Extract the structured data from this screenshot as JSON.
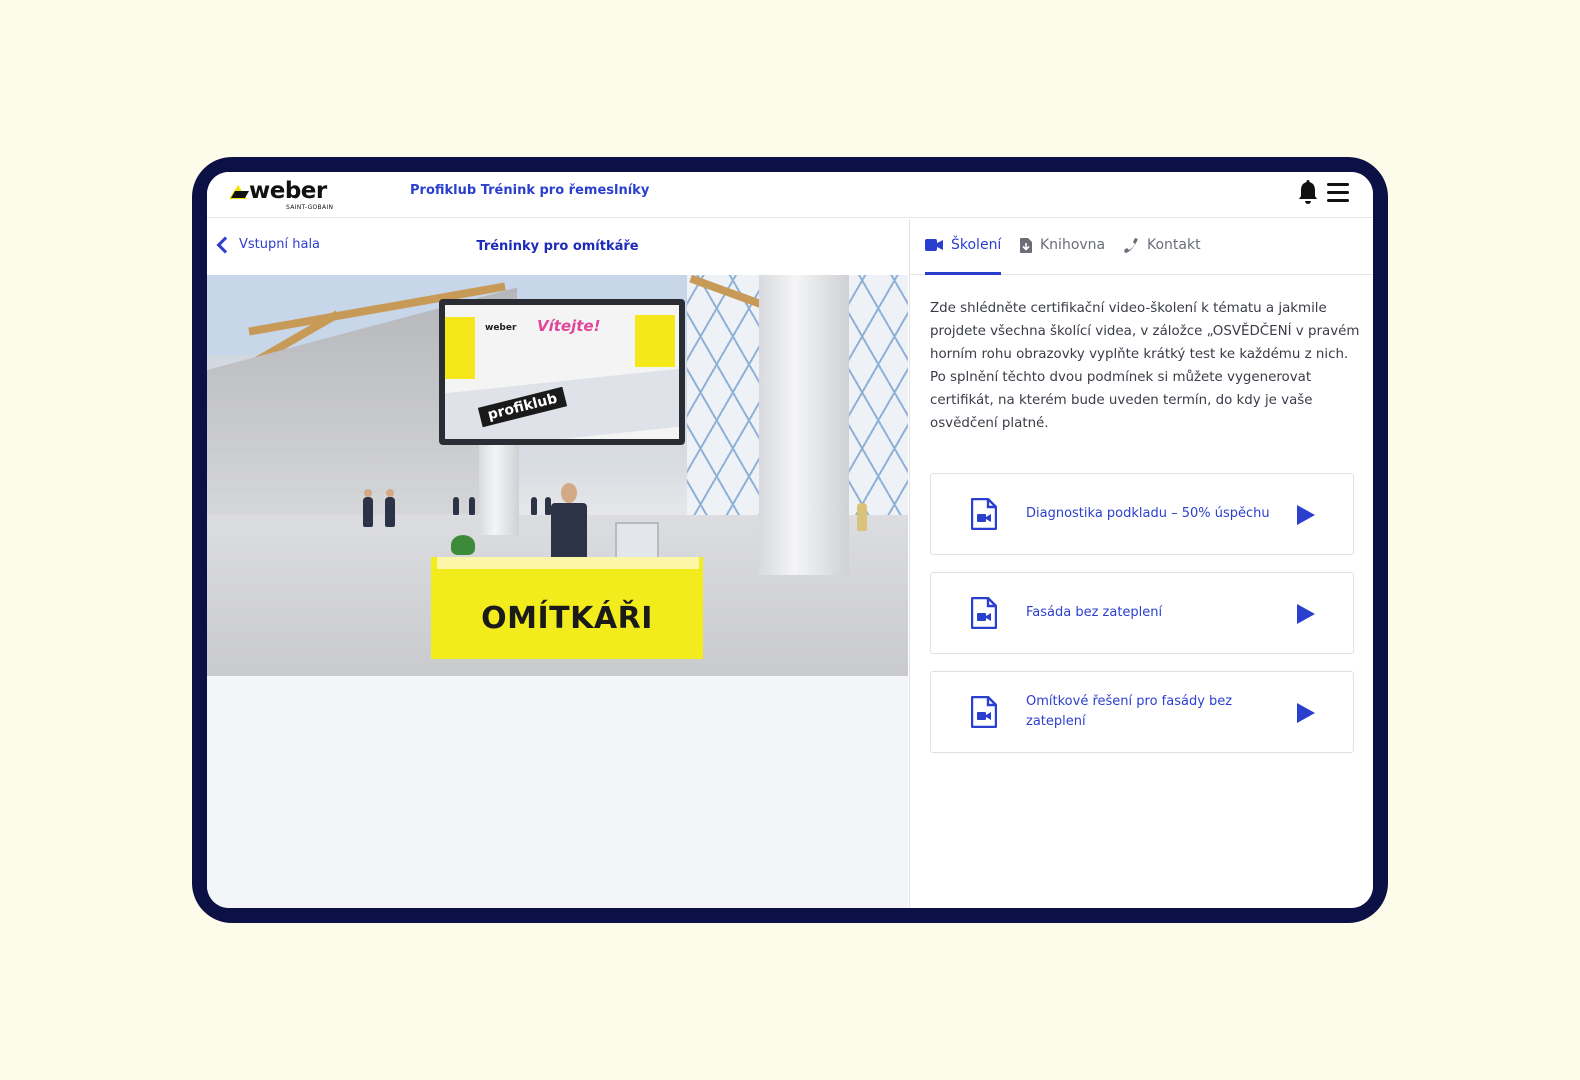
{
  "header": {
    "logo_text": "weber",
    "logo_subtext": "SAINT-GOBAIN",
    "app_title": "Profiklub Trénink pro řemeslníky",
    "icons": [
      "bell-icon",
      "hamburger-menu-icon"
    ]
  },
  "left": {
    "back_label": "Vstupní hala",
    "page_title": "Tréninky pro omítkáře",
    "scene": {
      "screen_welcome": "Vítejte!",
      "screen_brand": "weber",
      "screen_profiklub": "profiklub",
      "desk_label": "OMÍTKÁŘI"
    }
  },
  "right": {
    "tabs": [
      {
        "label": "Školení",
        "icon": "video-camera-icon",
        "active": true
      },
      {
        "label": "Knihovna",
        "icon": "file-download-icon",
        "active": false
      },
      {
        "label": "Kontakt",
        "icon": "phone-icon",
        "active": false
      }
    ],
    "description": "Zde shlédněte certifikační video-školení k tématu a jakmile projdete všechna školící videa, v záložce „OSVĚDČENÍ v pravém horním rohu obrazovky vyplňte krátký test ke každému z nich. Po splnění těchto dvou podmínek si můžete vygenerovat certifikát, na kterém bude uveden termín, do kdy je vaše osvědčení platné.",
    "videos": [
      {
        "label": "Diagnostika podkladu – 50% úspěchu"
      },
      {
        "label": "Fasáda bez zateplení"
      },
      {
        "label": "Omítkové řešení pro fasády bez zateplení"
      }
    ]
  },
  "colors": {
    "accent": "#2b3fcf",
    "frame": "#0c1145",
    "background": "#fdfbe9",
    "brand_yellow": "#f3ec1c"
  }
}
